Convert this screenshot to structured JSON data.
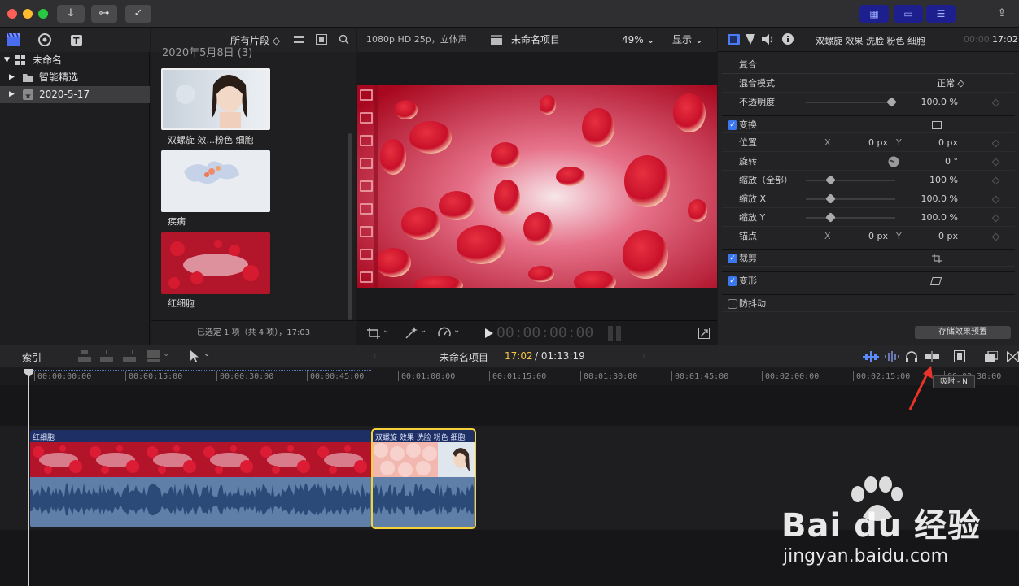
{
  "titlebar": {
    "buttons": [
      "↓",
      "⊶",
      "✓"
    ],
    "ws_buttons": [
      "▦",
      "▭",
      "☰"
    ],
    "share": "⇪"
  },
  "library": {
    "event_filter": "所有片段 ◇",
    "items": [
      {
        "label": "未命名",
        "indent": 0,
        "selected": false
      },
      {
        "label": "智能精选",
        "indent": 1,
        "selected": false
      },
      {
        "label": "2020-5-17",
        "indent": 1,
        "selected": true
      }
    ]
  },
  "browser": {
    "date_header": "2020年5月8日 (3)",
    "clips": [
      {
        "label": "双螺旋 效...粉色 细胞",
        "kind": "face"
      },
      {
        "label": "疾病",
        "kind": "map"
      },
      {
        "label": "红细胞",
        "kind": "cells"
      }
    ],
    "status": "已选定 1 项（共 4 项），17:03"
  },
  "viewer": {
    "format": "1080p HD 25p，立体声",
    "project": "未命名项目",
    "zoom": "49%",
    "display": "显示",
    "timecode": "00:00:00:00"
  },
  "inspector": {
    "clip_title": "双螺旋 效果 洗脸 粉色 细胞",
    "duration": "17:02",
    "duration_prefix": "00:00:",
    "composite_header": "复合",
    "blend_label": "混合模式",
    "blend_value": "正常 ◇",
    "opacity_label": "不透明度",
    "opacity_value": "100.0 %",
    "transform_header": "变换",
    "position_label": "位置",
    "x_label": "X",
    "y_label": "Y",
    "pos_x": "0 px",
    "pos_y": "0 px",
    "rotation_label": "旋转",
    "rotation_value": "0 °",
    "scale_all_label": "缩放（全部）",
    "scale_all_value": "100 %",
    "scale_x_label": "缩放 X",
    "scale_x_value": "100.0 %",
    "scale_y_label": "缩放 Y",
    "scale_y_value": "100.0 %",
    "anchor_label": "锚点",
    "anchor_x": "0 px",
    "anchor_y": "0 px",
    "crop_label": "裁剪",
    "distort_label": "变形",
    "stabilize_label": "防抖动",
    "save_preset": "存储效果预置"
  },
  "timeline": {
    "index_label": "索引",
    "project": "未命名项目",
    "timecode": "17:02",
    "total": "/ 01:13:19",
    "tooltip": "吸附 - N",
    "ruler": [
      "00:00:00:00",
      "00:00:15:00",
      "00:00:30:00",
      "00:00:45:00",
      "00:01:00:00",
      "00:01:15:00",
      "00:01:30:00",
      "00:01:45:00",
      "00:02:00:00",
      "00:02:15:00",
      "00:02:30:00"
    ],
    "clips": [
      {
        "label": "红细胞",
        "kind": "cells"
      },
      {
        "label": "双螺旋 效果 洗脸 粉色 细胞",
        "kind": "face"
      }
    ]
  },
  "watermark": {
    "brand": "Bai du 经验",
    "url": "jingyan.baidu.com"
  },
  "colors": {
    "accent": "#3b78f0",
    "selection": "#f5d23a",
    "clip_blue": "#1d2f64"
  }
}
